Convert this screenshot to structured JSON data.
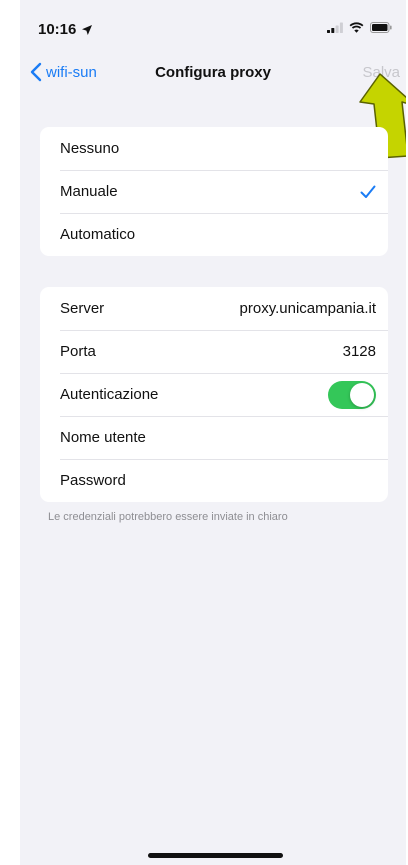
{
  "status_bar": {
    "time": "10:16",
    "icons": [
      "location-arrow-icon",
      "cellular-signal-icon",
      "wifi-icon",
      "battery-icon"
    ]
  },
  "nav": {
    "back_label": "wifi-sun",
    "title": "Configura proxy",
    "save_label": "Salva"
  },
  "proxy_modes": [
    {
      "label": "Nessuno",
      "selected": false
    },
    {
      "label": "Manuale",
      "selected": true
    },
    {
      "label": "Automatico",
      "selected": false
    }
  ],
  "settings": {
    "server": {
      "label": "Server",
      "value": "proxy.unicampania.it"
    },
    "port": {
      "label": "Porta",
      "value": "3128"
    },
    "auth": {
      "label": "Autenticazione",
      "enabled": true
    },
    "username": {
      "label": "Nome utente",
      "value": ""
    },
    "password": {
      "label": "Password",
      "value": ""
    }
  },
  "footer_note": "Le credenziali potrebbero essere inviate in chiaro",
  "colors": {
    "accent": "#1a7cf5",
    "toggle_on": "#34c759",
    "disabled_text": "#c7c7cc",
    "background": "#f2f2f7",
    "annotation_arrow": "#c5d400"
  }
}
